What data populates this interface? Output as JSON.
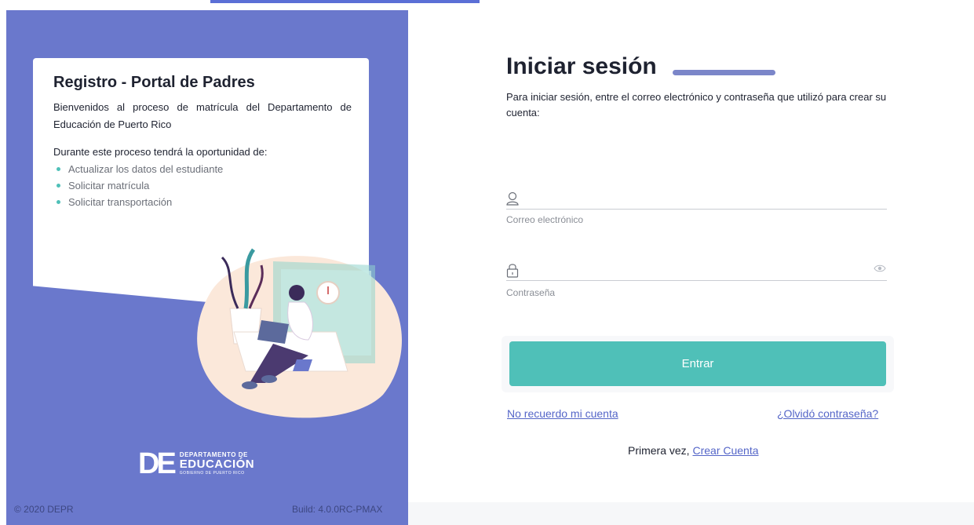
{
  "colors": {
    "panel": "#6a78cc",
    "accent": "#4fc0b8",
    "link": "#5566c8",
    "title_bar": "#7b86c9"
  },
  "info_card": {
    "title": "Registro - Portal de Padres",
    "intro": "Bienvenidos al proceso de matrícula del Departamento de Educación de Puerto Rico",
    "subtitle": "Durante este proceso tendrá la oportunidad de:",
    "items": [
      "Actualizar los datos del estudiante",
      "Solicitar matrícula",
      "Solicitar transportación"
    ]
  },
  "logo": {
    "mark": "DE",
    "line1": "DEPARTAMENTO DE",
    "line2": "EDUCACIÓN",
    "line3": "GOBIERNO DE PUERTO RICO"
  },
  "footer": {
    "copyright": "© 2020 DEPR",
    "build": "Build: 4.0.0RC-PMAX"
  },
  "login": {
    "title": "Iniciar sesión",
    "description": "Para iniciar sesión, entre el correo electrónico y contraseña que utilizó para crear su cuenta:",
    "email_label": "Correo electrónico",
    "email_value": "",
    "password_label": "Contraseña",
    "password_value": "",
    "submit_label": "Entrar",
    "forgot_account": "No recuerdo mi cuenta",
    "forgot_password": "¿Olvidó contraseña?",
    "first_time_prefix": "Primera vez,",
    "create_account": "Crear Cuenta"
  },
  "icons": {
    "email": "user-icon",
    "password": "lock-icon",
    "toggle": "eye-icon"
  }
}
